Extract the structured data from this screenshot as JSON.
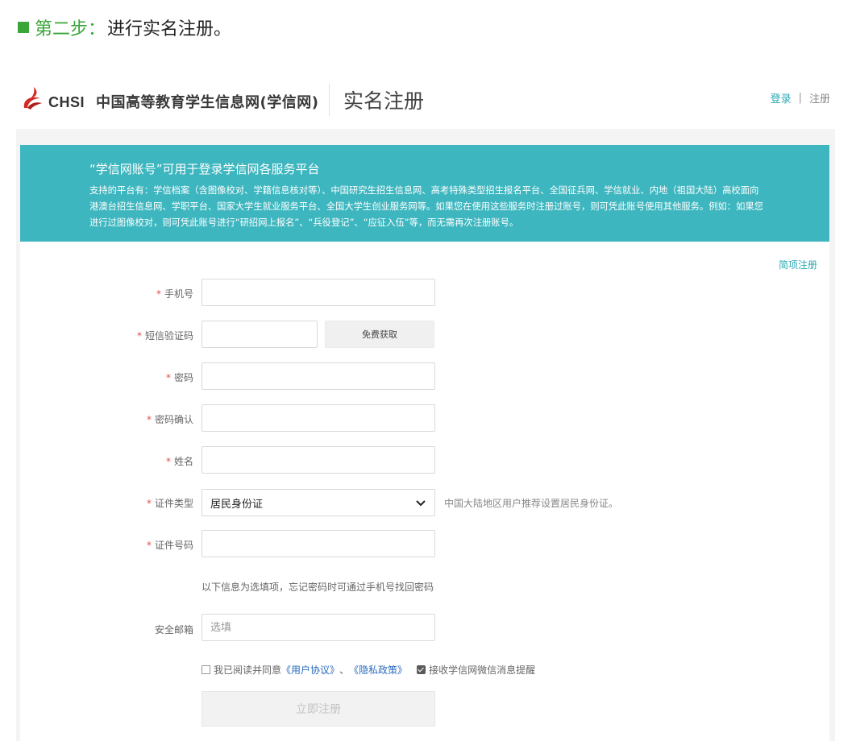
{
  "step": {
    "prefix": "第二步：",
    "text": "进行实名注册。"
  },
  "header": {
    "logo_text": "CHSI",
    "site_name": "中国高等教育学生信息网(学信网)",
    "page_title": "实名注册",
    "login_link": "登录",
    "separator": "|",
    "register_link": "注册"
  },
  "banner": {
    "title": "“学信网账号”可用于登录学信网各服务平台",
    "body": "支持的平台有：学信档案（含图像校对、学籍信息核对等）、中国研究生招生信息网、高考特殊类型招生报名平台、全国征兵网、学信就业、内地（祖国大陆）高校面向港澳台招生信息网、学职平台、国家大学生就业服务平台、全国大学生创业服务网等。如果您在使用这些服务时注册过账号，则可凭此账号使用其他服务。例如：如果您进行过图像校对，则可凭此账号进行“研招网上报名”、“兵役登记”、“应征入伍”等，而无需再次注册账号。"
  },
  "quick_register": "简项注册",
  "form": {
    "required_mark": "*",
    "phone_label": "手机号",
    "sms_label": "短信验证码",
    "sms_button": "免费获取",
    "password_label": "密码",
    "confirm_label": "密码确认",
    "name_label": "姓名",
    "id_type_label": "证件类型",
    "id_type_value": "居民身份证",
    "id_type_hint": "中国大陆地区用户推荐设置居民身份证。",
    "id_number_label": "证件号码",
    "optional_note": "以下信息为选填项，忘记密码时可通过手机号找回密码",
    "email_label": "安全邮箱",
    "email_placeholder": "选填",
    "agree_prefix": "我已阅读并同意",
    "user_agreement": "《用户协议》",
    "agree_sep": "、",
    "privacy_policy": "《隐私政策》",
    "wechat_notice": "接收学信网微信消息提醒",
    "submit": "立即注册"
  },
  "colors": {
    "banner_bg": "#3db6bf",
    "link": "#2aa8b5",
    "step_green": "#3aa63a",
    "required_red": "#e0504a"
  },
  "icons": {
    "logo": "chsi-torch-logo",
    "select_arrow": "chevron-down-icon"
  }
}
